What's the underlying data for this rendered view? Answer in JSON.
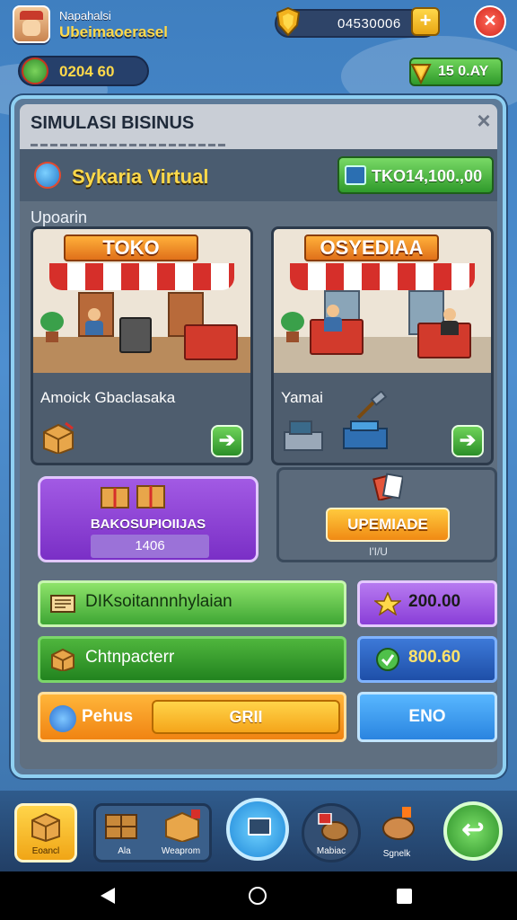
{
  "player": {
    "name": "Napahalsi",
    "subtitle": "Ubeimaoerasel"
  },
  "currency": {
    "coins": "04530006",
    "resource": "0204 60",
    "gems": "15 0.AY"
  },
  "panel": {
    "title": "SIMULASI BISINUS",
    "business_name": "Sykaria Virtual",
    "balance": "TKO14,100.,00",
    "section_label": "Upoarin"
  },
  "shops": [
    {
      "sign": "TOKO",
      "caption": "Amoick Gbaclasaka"
    },
    {
      "sign": "OSYEDIAA",
      "caption": "Yamai"
    }
  ],
  "promo": {
    "label": "BAKOSUPIOIIJAS",
    "count": "1406"
  },
  "upgrade": {
    "button": "UPEMIADE",
    "note": "I'I/U"
  },
  "actions": {
    "row1_left": "DIKsoitannnhylaian",
    "row1_right": "200.00",
    "row2_left": "Chtnpacterr",
    "row2_right": "800.60",
    "row3_left": "Pehus",
    "row3_inner": "GRII",
    "row3_right": "ENO"
  },
  "nav": {
    "home": "Eoancl",
    "item2a": "Ala",
    "item2b": "Weaprom",
    "item4": "Mabiac",
    "item5": "Sgnelk"
  },
  "colors": {
    "accent": "#ffd94a",
    "panel": "#5f6f80",
    "green": "#2f9a2b",
    "purple": "#8a3ed8",
    "blue": "#1e4fa8"
  }
}
